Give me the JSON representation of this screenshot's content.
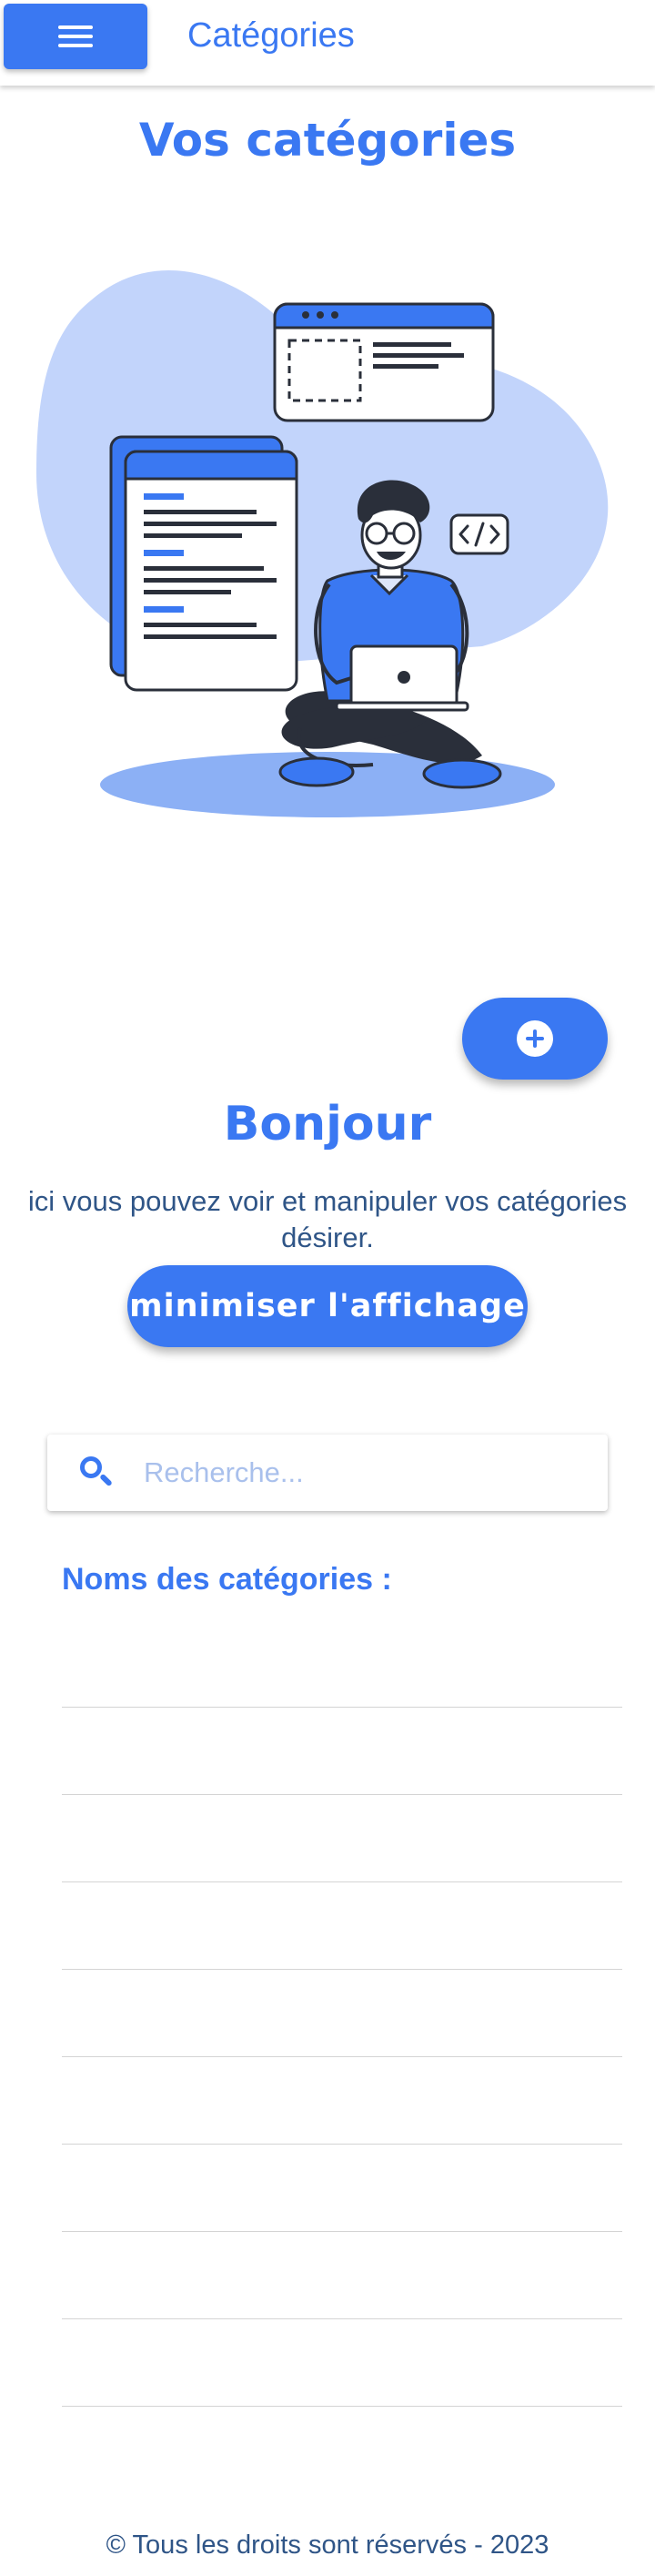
{
  "header": {
    "title": "Catégories",
    "menu_icon": "hamburger-icon"
  },
  "page": {
    "title": "Vos catégories"
  },
  "greeting": {
    "title": "Bonjour",
    "text": "ici vous pouvez voir et manipuler vos catégories désirer.",
    "toggle_label": "minimiser l'affichage"
  },
  "search": {
    "placeholder": "Recherche...",
    "value": "",
    "icon": "search-icon"
  },
  "categories": {
    "heading": "Noms des catégories :",
    "items": [
      {
        "label": ""
      },
      {
        "label": ""
      },
      {
        "label": ""
      },
      {
        "label": ""
      },
      {
        "label": ""
      },
      {
        "label": ""
      },
      {
        "label": ""
      },
      {
        "label": ""
      },
      {
        "label": ""
      }
    ]
  },
  "footer": {
    "text": "© Tous les droits sont réservés - 2023"
  },
  "colors": {
    "primary": "#3a78f2",
    "text": "#2f5587",
    "illustration_light": "#c2d4fb"
  }
}
